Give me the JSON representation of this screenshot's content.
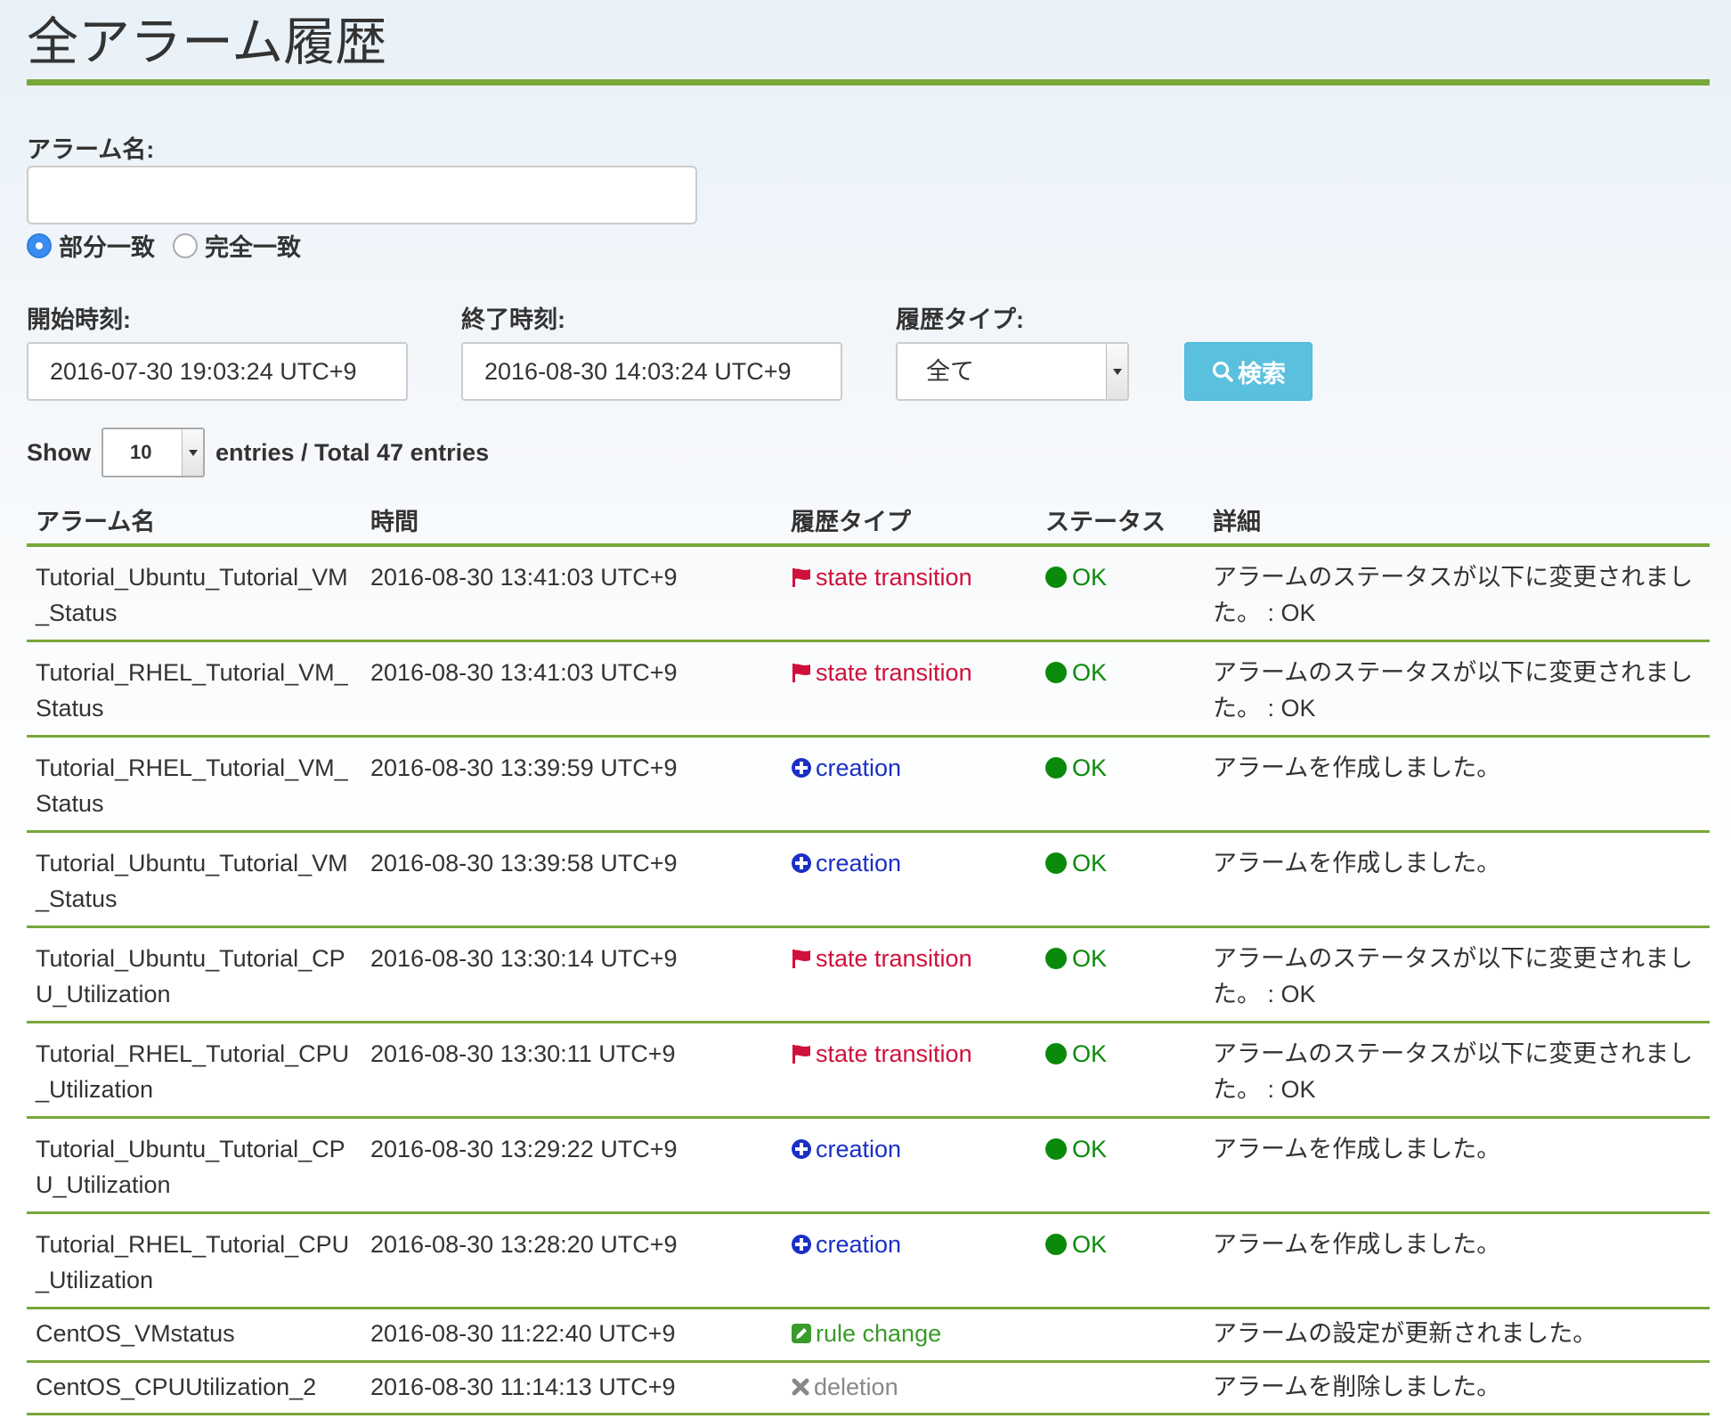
{
  "page": {
    "title": "全アラーム履歴"
  },
  "filters": {
    "alarm_name_label": "アラーム名:",
    "alarm_name_value": "",
    "match_options": [
      {
        "label": "部分一致",
        "selected": true
      },
      {
        "label": "完全一致",
        "selected": false
      }
    ],
    "start_label": "開始時刻:",
    "start_value": "2016-07-30 19:03:24 UTC+9",
    "end_label": "終了時刻:",
    "end_value": "2016-08-30 14:03:24 UTC+9",
    "type_label": "履歴タイプ:",
    "type_value": "全て",
    "search_label": "検索"
  },
  "paging": {
    "show_label": "Show",
    "entries_value": "10",
    "entries_suffix": "entries / Total 47 entries"
  },
  "table": {
    "headers": [
      "アラーム名",
      "時間",
      "履歴タイプ",
      "ステータス",
      "詳細"
    ],
    "rows": [
      {
        "name": "Tutorial_Ubuntu_Tutorial_VM_Status",
        "time": "2016-08-30 13:41:03 UTC+9",
        "type": "state transition",
        "type_key": "state",
        "status": "OK",
        "detail": "アラームのステータスが以下に変更されました。 : OK"
      },
      {
        "name": "Tutorial_RHEL_Tutorial_VM_Status",
        "time": "2016-08-30 13:41:03 UTC+9",
        "type": "state transition",
        "type_key": "state",
        "status": "OK",
        "detail": "アラームのステータスが以下に変更されました。 : OK"
      },
      {
        "name": "Tutorial_RHEL_Tutorial_VM_Status",
        "time": "2016-08-30 13:39:59 UTC+9",
        "type": "creation",
        "type_key": "creation",
        "status": "OK",
        "detail": "アラームを作成しました。"
      },
      {
        "name": "Tutorial_Ubuntu_Tutorial_VM_Status",
        "time": "2016-08-30 13:39:58 UTC+9",
        "type": "creation",
        "type_key": "creation",
        "status": "OK",
        "detail": "アラームを作成しました。"
      },
      {
        "name": "Tutorial_Ubuntu_Tutorial_CPU_Utilization",
        "time": "2016-08-30 13:30:14 UTC+9",
        "type": "state transition",
        "type_key": "state",
        "status": "OK",
        "detail": "アラームのステータスが以下に変更されました。 : OK"
      },
      {
        "name": "Tutorial_RHEL_Tutorial_CPU_Utilization",
        "time": "2016-08-30 13:30:11 UTC+9",
        "type": "state transition",
        "type_key": "state",
        "status": "OK",
        "detail": "アラームのステータスが以下に変更されました。 : OK"
      },
      {
        "name": "Tutorial_Ubuntu_Tutorial_CPU_Utilization",
        "time": "2016-08-30 13:29:22 UTC+9",
        "type": "creation",
        "type_key": "creation",
        "status": "OK",
        "detail": "アラームを作成しました。"
      },
      {
        "name": "Tutorial_RHEL_Tutorial_CPU_Utilization",
        "time": "2016-08-30 13:28:20 UTC+9",
        "type": "creation",
        "type_key": "creation",
        "status": "OK",
        "detail": "アラームを作成しました。"
      },
      {
        "name": "CentOS_VMstatus",
        "time": "2016-08-30 11:22:40 UTC+9",
        "type": "rule change",
        "type_key": "rule",
        "status": "",
        "detail": "アラームの設定が更新されました。"
      },
      {
        "name": "CentOS_CPUUtilization_2",
        "time": "2016-08-30 11:14:13 UTC+9",
        "type": "deletion",
        "type_key": "deletion",
        "status": "",
        "detail": "アラームを削除しました。"
      }
    ]
  },
  "icons": {
    "state": "flag-icon",
    "creation": "plus-circle-icon",
    "rule": "edit-icon",
    "deletion": "x-icon",
    "status_ok": "green-dot-icon",
    "search": "search-icon"
  },
  "colors": {
    "accent_green": "#78a73a",
    "state_red": "#d0103a",
    "creation_blue": "#1a2fc6",
    "rule_green": "#3a9a2a",
    "deletion_gray": "#888888",
    "ok_green": "#0a8a0a",
    "search_button": "#5bc0de"
  }
}
